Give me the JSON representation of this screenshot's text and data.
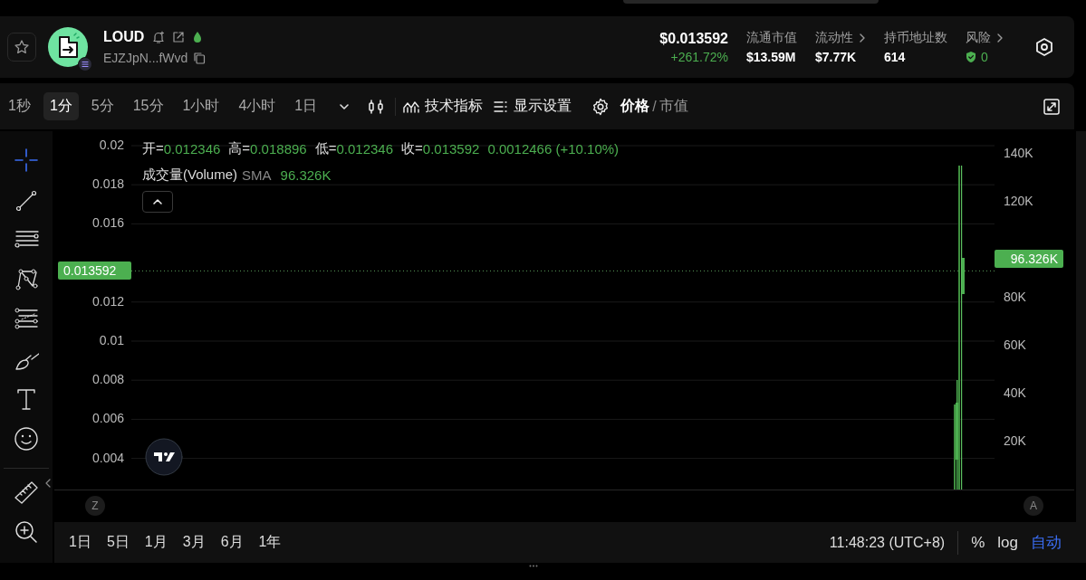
{
  "header": {
    "symbol": "LOUD",
    "address": "EJZJpN...fWvd",
    "price": "$0.013592",
    "change": "+261.72%",
    "stats": [
      {
        "label": "流通市值",
        "value": "$13.59M",
        "expandable": false,
        "kind": "plain"
      },
      {
        "label": "流动性",
        "value": "$7.77K",
        "expandable": true,
        "kind": "plain"
      },
      {
        "label": "持币地址数",
        "value": "614",
        "expandable": false,
        "kind": "plain"
      },
      {
        "label": "风险",
        "value": "0",
        "expandable": true,
        "kind": "risk"
      }
    ]
  },
  "toolbar": {
    "intervals": [
      {
        "label": "1秒",
        "selected": false
      },
      {
        "label": "1分",
        "selected": true
      },
      {
        "label": "5分",
        "selected": false
      },
      {
        "label": "15分",
        "selected": false
      },
      {
        "label": "1小时",
        "selected": false
      },
      {
        "label": "4小时",
        "selected": false
      },
      {
        "label": "1日",
        "selected": false
      }
    ],
    "indicators": "技术指标",
    "display": "显示设置",
    "modes": [
      {
        "label": "价格",
        "selected": true
      },
      {
        "label": "市值",
        "selected": false
      }
    ],
    "mode_separator": "/"
  },
  "drawing_tools": [
    {
      "kind": "crosshair",
      "selected": true
    },
    {
      "kind": "trend-line",
      "selected": false
    },
    {
      "kind": "parallel-lines",
      "selected": false
    },
    {
      "kind": "pattern",
      "selected": false
    },
    {
      "kind": "fib",
      "selected": false
    },
    {
      "kind": "brush",
      "selected": false
    },
    {
      "kind": "text",
      "selected": false
    },
    {
      "kind": "emoji",
      "selected": false
    },
    {
      "kind": "ruler",
      "selected": false
    },
    {
      "kind": "zoom",
      "selected": false
    }
  ],
  "chart": {
    "legend": [
      {
        "label": "开=",
        "value": "0.012346"
      },
      {
        "label": "高=",
        "value": "0.018896"
      },
      {
        "label": "低=",
        "value": "0.012346"
      },
      {
        "label": "收=",
        "value": "0.013592"
      }
    ],
    "legend_change": "0.0012466 (+10.10%)",
    "volume_name": "成交量(Volume)",
    "volume_ma": "SMA",
    "volume_value": "96.326K",
    "price_axis": [
      "0.02",
      "0.018",
      "0.016",
      "0.012",
      "0.01",
      "0.008",
      "0.006",
      "0.004"
    ],
    "volume_axis": [
      "140K",
      "120K",
      "80K",
      "60K",
      "40K",
      "20K"
    ],
    "last_price": "0.013592",
    "last_volume": "96.326K",
    "scale_left": "Z",
    "scale_right": "A"
  },
  "footer": {
    "ranges": [
      "1日",
      "5日",
      "1月",
      "3月",
      "6月",
      "1年"
    ],
    "time": "11:48:23 (UTC+8)",
    "options": [
      {
        "label": "%",
        "selected": false
      },
      {
        "label": "log",
        "selected": false
      },
      {
        "label": "自动",
        "selected": true
      }
    ]
  }
}
